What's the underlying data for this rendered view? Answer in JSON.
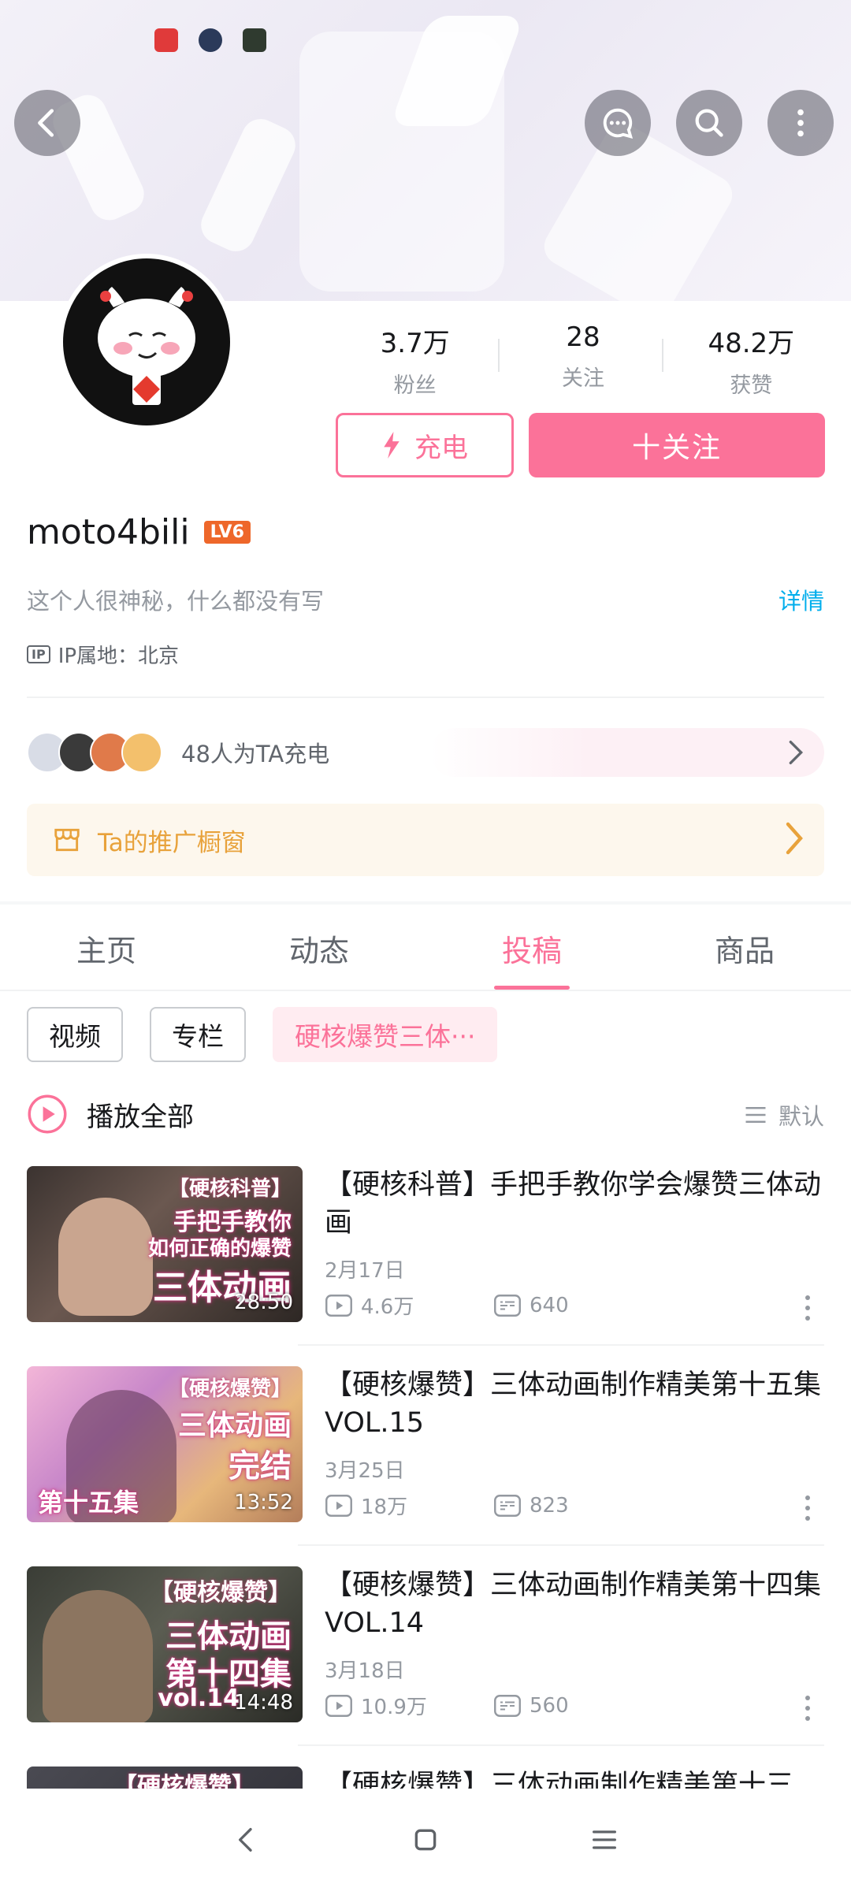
{
  "header": {
    "status_icons": [
      "netease-music-icon",
      "app-icon",
      "app-icon"
    ],
    "back_icon": "chevron-left-icon",
    "actions": [
      "message-icon",
      "search-icon",
      "more-vertical-icon"
    ]
  },
  "profile": {
    "username": "moto4bili",
    "level": "LV6",
    "bio": "这个人很神秘，什么都没有写",
    "detail_link": "详情",
    "ip_label": "IP属地：北京",
    "ip_icon_text": "IP"
  },
  "stats": [
    {
      "value": "3.7万",
      "label": "粉丝"
    },
    {
      "value": "28",
      "label": "关注"
    },
    {
      "value": "48.2万",
      "label": "获赞"
    }
  ],
  "buttons": {
    "charge": "充电",
    "follow": "十关注"
  },
  "chargers": {
    "count_text": "48人为TA充电"
  },
  "shop": {
    "label": "Ta的推广橱窗"
  },
  "tabs": [
    {
      "label": "主页",
      "active": false
    },
    {
      "label": "动态",
      "active": false
    },
    {
      "label": "投稿",
      "active": true
    },
    {
      "label": "商品",
      "active": false
    }
  ],
  "chips": [
    {
      "label": "视频",
      "active": false
    },
    {
      "label": "专栏",
      "active": false
    },
    {
      "label": "硬核爆赞三体···",
      "active": true
    }
  ],
  "list_header": {
    "play_all": "播放全部",
    "sort": "默认"
  },
  "videos": [
    {
      "title": "【硬核科普】手把手教你学会爆赞三体动画",
      "date": "2月17日",
      "views": "4.6万",
      "comments": "640",
      "duration": "28:50",
      "thumb_tag": "【硬核科普】",
      "thumb_lines": [
        "手把手教你",
        "如何正确的爆赞",
        "三体动画"
      ]
    },
    {
      "title": "【硬核爆赞】三体动画制作精美第十五集VOL.15",
      "date": "3月25日",
      "views": "18万",
      "comments": "823",
      "duration": "13:52",
      "thumb_tag": "【硬核爆赞】",
      "thumb_lines": [
        "三体动画",
        "完结",
        "第十五集"
      ]
    },
    {
      "title": "【硬核爆赞】三体动画制作精美第十四集 VOL.14",
      "date": "3月18日",
      "views": "10.9万",
      "comments": "560",
      "duration": "14:48",
      "thumb_tag": "【硬核爆赞】",
      "thumb_lines": [
        "三体动画",
        "第十四集",
        "vol.14"
      ]
    },
    {
      "title": "【硬核爆赞】三体动画制作精美第十三",
      "thumb_tag": "【硬核爆赞】"
    }
  ],
  "colors": {
    "accent": "#fb7299",
    "link": "#00aeec",
    "shop": "#e8a23b",
    "muted": "#9499a0"
  }
}
